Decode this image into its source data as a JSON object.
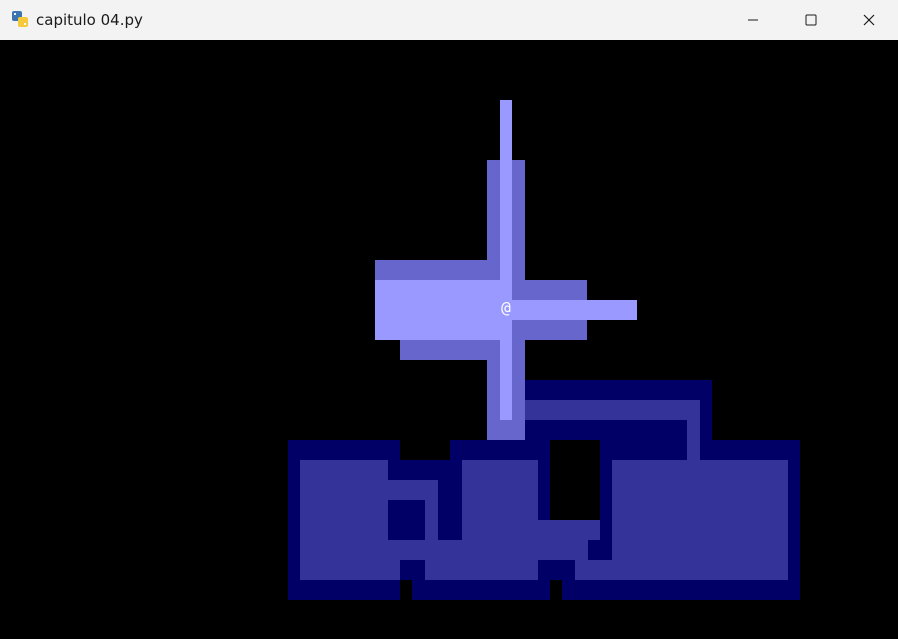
{
  "window": {
    "title": "capitulo 04.py",
    "icon": "python-icon",
    "controls": {
      "minimize": "minimize-icon",
      "maximize": "maximize-icon",
      "close": "close-icon"
    }
  },
  "game": {
    "player_glyph": "@",
    "colors": {
      "background": "#000000",
      "light_wall": "#6666cc",
      "light_floor": "#9999ff",
      "dark_wall": "#000066",
      "dark_floor": "#333399",
      "player": "#ffffff"
    }
  }
}
